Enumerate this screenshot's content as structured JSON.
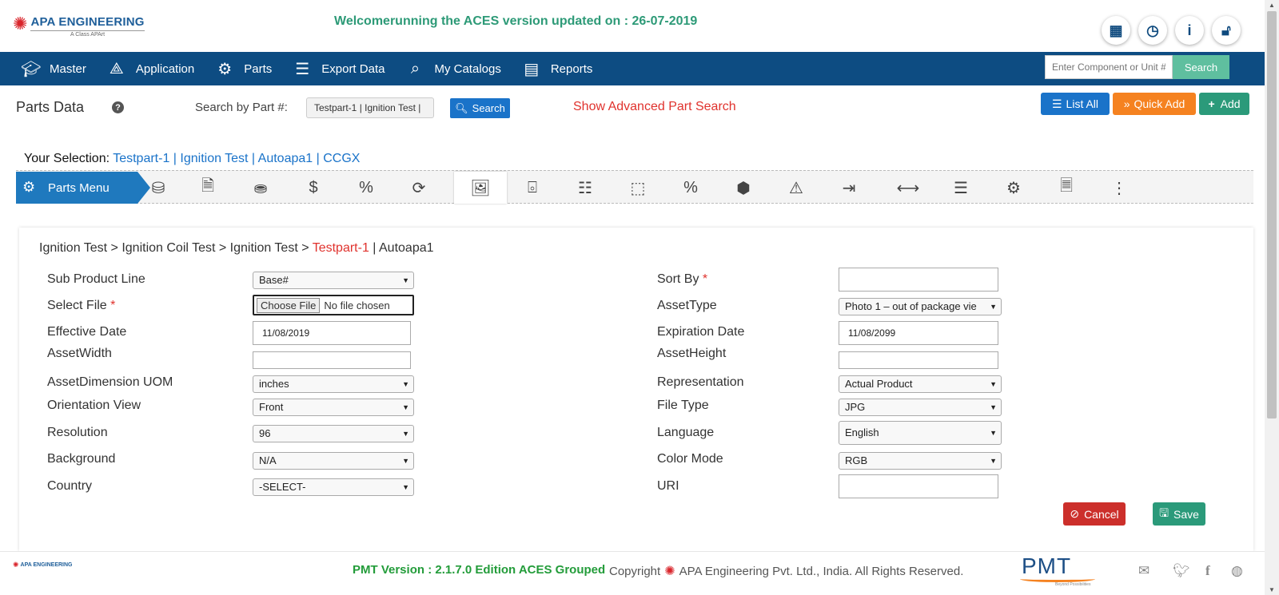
{
  "header": {
    "brand": "APA ENGINEERING",
    "tagline": "A Class APArt",
    "marquee": "Welcomerunning the ACES version updated on : 26-07-2019",
    "icons": [
      "dashboard-icon",
      "clock-icon",
      "info-icon",
      "unlock-icon"
    ]
  },
  "nav": {
    "items": [
      {
        "label": "Master",
        "icon": "graduation-cap-icon"
      },
      {
        "label": "Application",
        "icon": "compass-icon"
      },
      {
        "label": "Parts",
        "icon": "cogs-icon"
      },
      {
        "label": "Export Data",
        "icon": "database-icon"
      },
      {
        "label": "My Catalogs",
        "icon": "catalog-search-icon"
      },
      {
        "label": "Reports",
        "icon": "report-icon"
      }
    ],
    "search_placeholder": "Enter Component or Unit #",
    "search_button": "Search"
  },
  "toolbar": {
    "page_title": "Parts Data",
    "search_label": "Search by Part #:",
    "search_value": "Testpart-1 | Ignition Test |",
    "search_button": "Search",
    "advanced_link": "Show Advanced Part Search",
    "list_all": "List All",
    "quick_add": "Quick Add",
    "add": "Add"
  },
  "selection": {
    "label": "Your Selection:",
    "value": "Testpart-1 | Ignition Test | Autoapa1 | CCGX"
  },
  "parts_menu": {
    "label": "Parts Menu",
    "icons": [
      "database-gear-icon",
      "document-info-icon",
      "money-hand-icon",
      "dollar-bag-icon",
      "percent-doc-icon",
      "refresh-icon",
      "image-icon",
      "focus-info-icon",
      "bom-icon",
      "dimensions-icon",
      "discount-icon",
      "box-icon",
      "warning-icon",
      "export-icon",
      "width-arrows-icon",
      "add-list-icon",
      "doc-settings-icon",
      "doc-info2-icon",
      "hierarchy-icon"
    ],
    "active_index": 6
  },
  "form": {
    "breadcrumb": {
      "path": "Ignition Test > Ignition Coil Test > Ignition Test > ",
      "highlight": "Testpart-1",
      "suffix": " | Autoapa1"
    },
    "sub_product_line": {
      "label": "Sub Product Line",
      "value": "Base#"
    },
    "select_file": {
      "label": "Select File",
      "button": "Choose File",
      "status": "No file chosen"
    },
    "effective_date": {
      "label": "Effective Date",
      "value": "11/08/2019"
    },
    "asset_width": {
      "label": "AssetWidth",
      "value": ""
    },
    "asset_uom": {
      "label": "AssetDimension UOM",
      "value": "inches"
    },
    "orientation": {
      "label": "Orientation View",
      "value": "Front"
    },
    "resolution": {
      "label": "Resolution",
      "value": "96"
    },
    "background": {
      "label": "Background",
      "value": "N/A"
    },
    "country": {
      "label": "Country",
      "value": "-SELECT-"
    },
    "sort_by": {
      "label": "Sort By",
      "value": ""
    },
    "asset_type": {
      "label": "AssetType",
      "value": "Photo 1 – out of package vie"
    },
    "expiration_date": {
      "label": "Expiration Date",
      "value": "11/08/2099"
    },
    "asset_height": {
      "label": "AssetHeight",
      "value": ""
    },
    "representation": {
      "label": "Representation",
      "value": "Actual Product"
    },
    "file_type": {
      "label": "File Type",
      "value": "JPG"
    },
    "language": {
      "label": "Language",
      "value": "English"
    },
    "color_mode": {
      "label": "Color Mode",
      "value": "RGB"
    },
    "uri": {
      "label": "URI",
      "value": ""
    },
    "required_mark": "*",
    "cancel": "Cancel",
    "save": "Save"
  },
  "footer": {
    "brand": "APA ENGINEERING",
    "version": "PMT Version : 2.1.7.0 Edition ACES Grouped",
    "copyright_prefix": "Copyright",
    "copyright_text": "APA Engineering Pvt. Ltd., India. All Rights Reserved.",
    "pmt_logo": "PMT",
    "pmt_sub": "Beyond Possibilities",
    "social": [
      "mail-icon",
      "twitter-icon",
      "facebook-icon",
      "globe-icon"
    ]
  }
}
